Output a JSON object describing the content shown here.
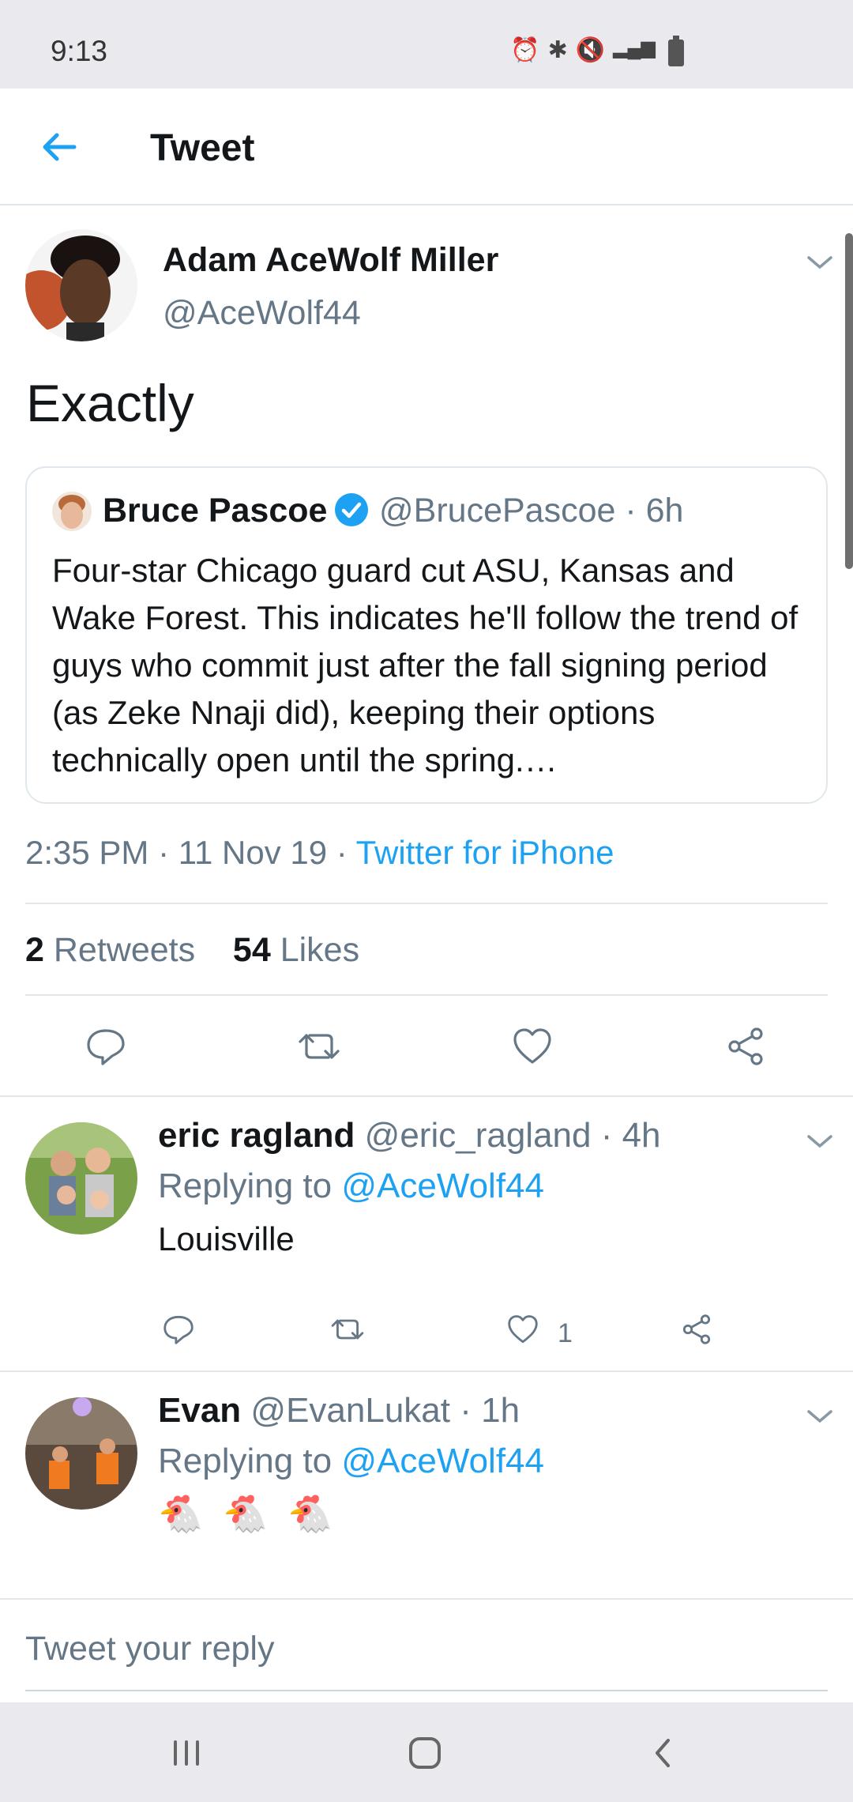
{
  "status_bar": {
    "time": "9:13"
  },
  "header": {
    "title": "Tweet"
  },
  "tweet": {
    "author_name": "Adam AceWolf Miller",
    "author_handle": "@AceWolf44",
    "text": "Exactly",
    "quoted": {
      "author_name": "Bruce Pascoe",
      "author_handle": "@BrucePascoe · 6h",
      "text": "Four-star Chicago guard cut ASU, Kansas and Wake Forest. This indicates he'll follow the trend of guys who commit just after the fall signing period (as Zeke Nnaji did), keeping their options technically open until the spring.…"
    },
    "time": "2:35 PM · 11 Nov 19 · ",
    "source": "Twitter for iPhone",
    "retweets_count": "2",
    "retweets_label": "Retweets",
    "likes_count": "54",
    "likes_label": "Likes"
  },
  "replies": [
    {
      "name": "eric ragland",
      "meta": "@eric_ragland · 4h",
      "replying_prefix": "Replying to ",
      "replying_to": "@AceWolf44",
      "text": "Louisville",
      "like_count": "1"
    },
    {
      "name": "Evan",
      "meta": "@EvanLukat · 1h",
      "replying_prefix": "Replying to ",
      "replying_to": "@AceWolf44",
      "text": "🐔 🐔 🐔"
    }
  ],
  "reply_bar": {
    "placeholder": "Tweet your reply"
  },
  "colors": {
    "accent": "#1da1f2",
    "secondary_text": "#657786",
    "divider": "#e1e8ed"
  }
}
